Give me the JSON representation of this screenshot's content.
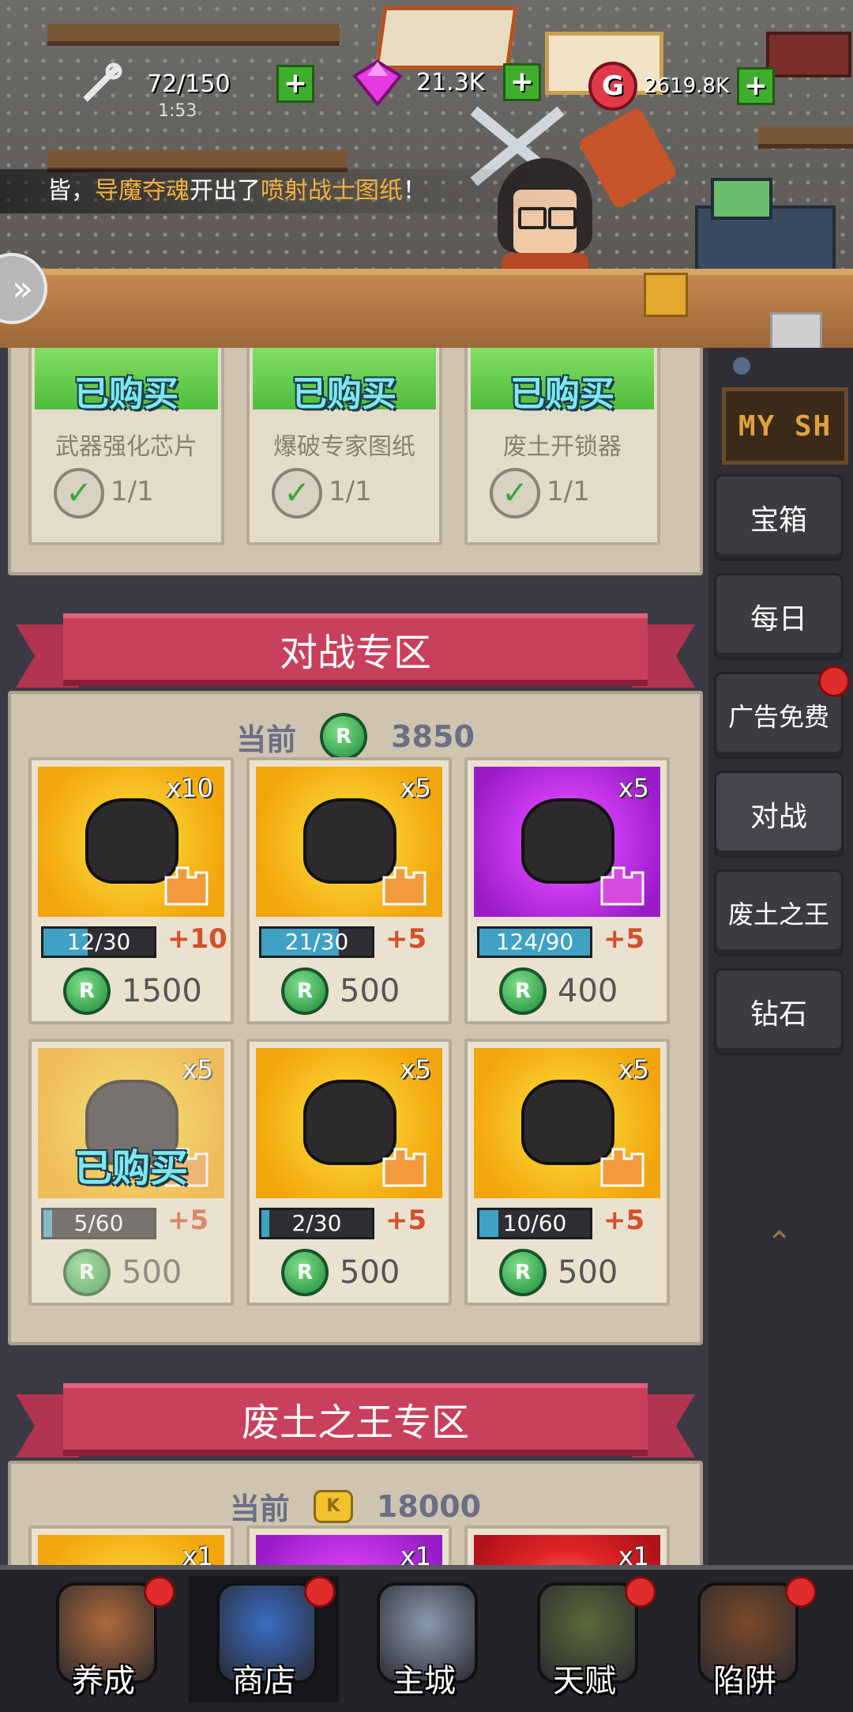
{
  "top_bar": {
    "energy": "72/150",
    "energy_timer": "1:53",
    "gems": "21.3K",
    "gold": "2619.8K",
    "plus": "+"
  },
  "ticker": {
    "prefix": "皆，",
    "player": "导魔夺魂",
    "mid": "开出了",
    "item": "喷射战士图纸",
    "suffix": "！"
  },
  "side_arrow": "»",
  "top_cards": [
    {
      "status": "已购买",
      "name": "武器强化芯片",
      "count": "1/1"
    },
    {
      "status": "已购买",
      "name": "爆破专家图纸",
      "count": "1/1"
    },
    {
      "status": "已购买",
      "name": "废土开锁器",
      "count": "1/1"
    }
  ],
  "battle_section": {
    "title": "对战专区",
    "current_label": "当前",
    "currency_icon": "R",
    "balance": "3850",
    "items": [
      {
        "qty": "x10",
        "progress": "12/30",
        "fill": 0.4,
        "bonus": "+10",
        "price": "1500",
        "bg": "gold",
        "bought": false
      },
      {
        "qty": "x5",
        "progress": "21/30",
        "fill": 0.7,
        "bonus": "+5",
        "price": "500",
        "bg": "gold",
        "bought": false
      },
      {
        "qty": "x5",
        "progress": "124/90",
        "fill": 1.0,
        "bonus": "+5",
        "price": "400",
        "bg": "purple",
        "bought": false
      },
      {
        "qty": "x5",
        "progress": "5/60",
        "fill": 0.08,
        "bonus": "+5",
        "price": "500",
        "bg": "gold",
        "bought": true,
        "status": "已购买"
      },
      {
        "qty": "x5",
        "progress": "2/30",
        "fill": 0.07,
        "bonus": "+5",
        "price": "500",
        "bg": "gold",
        "bought": false
      },
      {
        "qty": "x5",
        "progress": "10/60",
        "fill": 0.17,
        "bonus": "+5",
        "price": "500",
        "bg": "gold",
        "bought": false
      }
    ]
  },
  "king_section": {
    "title": "废土之王专区",
    "current_label": "当前",
    "currency_icon": "K",
    "balance": "18000",
    "items": [
      {
        "qty": "x1",
        "bg": "gold"
      },
      {
        "qty": "x1",
        "bg": "purple"
      },
      {
        "qty": "x1",
        "bg": "red"
      }
    ]
  },
  "right_nav": {
    "sign": "MY SH",
    "items": [
      {
        "label": "宝箱",
        "badge": false
      },
      {
        "label": "每日",
        "badge": false
      },
      {
        "label": "广告免费",
        "badge": true
      },
      {
        "label": "对战",
        "badge": false,
        "active": true
      },
      {
        "label": "废土之王",
        "badge": false
      },
      {
        "label": "钻石",
        "badge": false
      }
    ]
  },
  "bottom_nav": [
    {
      "label": "养成",
      "badge": true,
      "icon": "character-icon"
    },
    {
      "label": "商店",
      "badge": true,
      "icon": "shop-icon",
      "active": true
    },
    {
      "label": "主城",
      "badge": false,
      "icon": "main-city-icon"
    },
    {
      "label": "天赋",
      "badge": true,
      "icon": "talent-icon"
    },
    {
      "label": "陷阱",
      "badge": true,
      "icon": "trap-icon"
    }
  ],
  "colors": {
    "ribbon": "#c9405c",
    "bought_text": "#7de8f0",
    "bonus": "#d2502a",
    "progress_fill": "#3fa1c4"
  }
}
